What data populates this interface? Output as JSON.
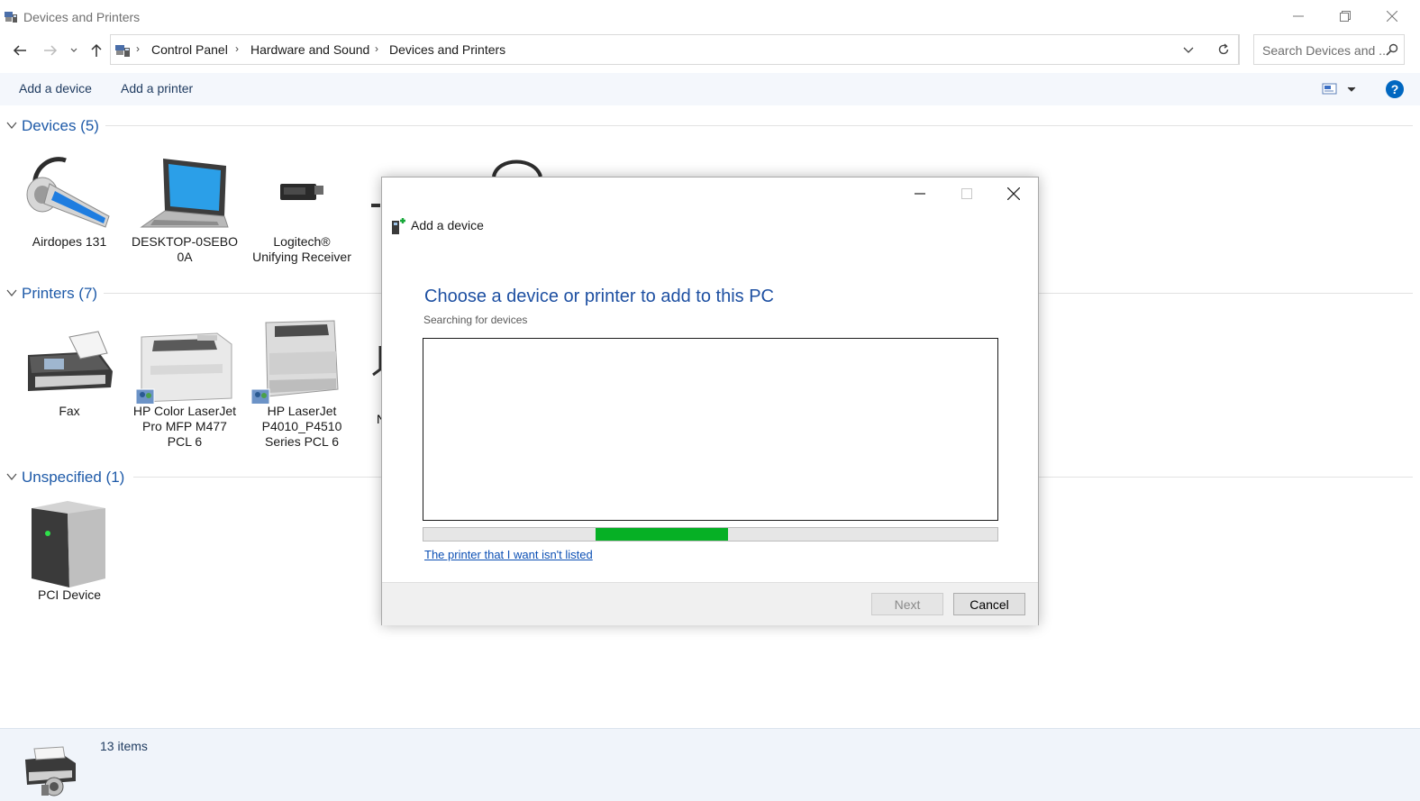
{
  "window": {
    "title": "Devices and Printers",
    "controls": [
      "minimize",
      "restore",
      "close"
    ]
  },
  "address_bar": {
    "breadcrumbs": [
      "Control Panel",
      "Hardware and Sound",
      "Devices and Printers"
    ],
    "search_placeholder": "Search Devices and ..."
  },
  "command_bar": {
    "add_device_label": "Add a device",
    "add_printer_label": "Add a printer",
    "help_label": "?"
  },
  "groups": {
    "devices": {
      "title": "Devices (5)",
      "items": [
        {
          "label": "Airdopes 131",
          "icon": "headset-icon"
        },
        {
          "label": "DESKTOP-0SEBO\n0A",
          "icon": "laptop-icon"
        },
        {
          "label": "Logitech®\nUnifying Receiver",
          "icon": "usb-receiver-icon"
        }
      ]
    },
    "printers": {
      "title": "Printers (7)",
      "items": [
        {
          "label": "Fax",
          "icon": "fax-icon"
        },
        {
          "label": "HP Color LaserJet\nPro MFP M477\nPCL 6",
          "icon": "printer-icon"
        },
        {
          "label": "HP LaserJet\nP4010_P4510\nSeries PCL 6",
          "icon": "printer-icon"
        }
      ],
      "partial_label": "N"
    },
    "unspecified": {
      "title": "Unspecified (1)",
      "items": [
        {
          "label": "PCI Device",
          "icon": "server-icon"
        }
      ]
    }
  },
  "status_bar": {
    "item_count": "13 items"
  },
  "dialog": {
    "title": "Add a device",
    "heading": "Choose a device or printer to add to this PC",
    "subheading": "Searching for devices",
    "progress": {
      "start": 0.3,
      "end": 0.53,
      "color": "#06b025"
    },
    "link_text": "The printer that I want isn't listed",
    "next_label": "Next",
    "cancel_label": "Cancel",
    "next_enabled": false
  },
  "colors": {
    "accent": "#1e5aa8",
    "command_bar_bg": "#f4f7fc",
    "progress_green": "#06b025"
  }
}
